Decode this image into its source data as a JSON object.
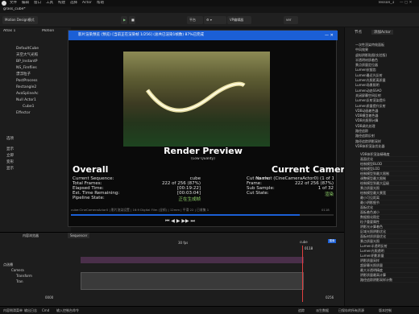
{
  "menu": {
    "items": [
      "文件",
      "编辑",
      "窗口",
      "工具",
      "构建",
      "选择",
      "Actor",
      "帮助"
    ],
    "project": "grass_cube*",
    "tab_lesson": "lesson_1"
  },
  "toolbar": {
    "mode": "Motion Design模式",
    "label_a": "播放选项",
    "label_b": "平台",
    "dropdown": "VP编辑器",
    "search_ph": "ver"
  },
  "left_panel": {
    "title_a": "Atlas 1",
    "title_b": "Motion",
    "outliner": [
      "DefaultCube",
      "天空大气光照",
      "BP_InstantP",
      "NS_Fireflies",
      "漂浮粒子",
      "PostProcess",
      "Rectangle2",
      "AvaSplineAc",
      "Null Actor1",
      "Cube1",
      "Effector"
    ],
    "details_title": "选项",
    "details": [
      "显示",
      "立即",
      "变形",
      "显示"
    ]
  },
  "dialog": {
    "title": "影片渲染预览 (预览) [当前正在渲染帧 1/256] (总共已渲染1帧数) 87%已完成",
    "render_title": "Render Preview",
    "render_sub": "(Low Quality)",
    "overall": "Overall",
    "current": "Current Camera Cut",
    "left_stats": [
      [
        "Current Sequence:",
        "cube"
      ],
      [
        "Total Frames:",
        "222 of 256 (87%)"
      ],
      [
        "Elapsed Time:",
        "[00:19:22]"
      ],
      [
        "Est. Time Remaining:",
        "[00:03:04]"
      ],
      [
        "Pipeline State:",
        "正在生成帧"
      ]
    ],
    "right_stats": [
      [
        "Cut Name:",
        "no shot (CineCameraActor0) (1 of 1)"
      ],
      [
        "Frame:",
        "222 of 256 (87%)"
      ],
      [
        "Sub Sample:",
        "1 of 32"
      ],
      [
        "Cut State:",
        "渲染"
      ]
    ],
    "footer": "cube:CineCameraActor0 | 影片渲染设置 | 16:9 Digital Film (全帧) | 12mm | 平滑 22 | 已收集 1",
    "footer_right": "0118"
  },
  "right_panel": {
    "title": "节点",
    "add": "添加Actor",
    "items": [
      "一次性渲染特效面板",
      "中风效果",
      "虚拟阴影贴图(实验版)",
      "半透明材质着色",
      "景点质量定位器",
      "Lumen抗锯齿",
      "Lumen最近光反射",
      "Lumen光照距离质量",
      "Lumen场景照明",
      "Lumen动态SSAO",
      "关闭屏幕空间反射",
      "Lumen反射渲染提升",
      "Lumen质量提升反射",
      "VDB动画着色器",
      "VDB模型着色器",
      "VDB光照预计算",
      "VDB调光处理",
      "路径追踪",
      "路径追踪反射",
      "路径追踪阴影采样",
      "VDB体积渲染优化器"
    ],
    "items2": [
      "VDB体积渲染精确度",
      "画面优化",
      "绘制模型BLOD",
      "绘制模型LOD",
      "绘制模型到最大限制",
      "调整模型最大限制",
      "绘制模型到最大层级",
      "景点质量光照",
      "绘制模型最大景宽",
      "最小可见距离",
      "最小阴影细节",
      "面板优化",
      "面板着色减小",
      "数据细化稳定",
      "粒子重要属性",
      "阴影光计算着色",
      "区域光照阴影优化",
      "面板材质质量优化",
      "景点质量光照",
      "Lumen半透明反射",
      "Lumen光照透明",
      "Lumen阴影质量",
      "阴影质量采样",
      "超屏幕光照质量",
      "最大半透明精度",
      "阴影质量最高计算",
      "路径追踪阴影采样计数"
    ]
  },
  "sequencer": {
    "tab1": "内容浏览器",
    "tab2": "Sequencer",
    "fps": "30 fps",
    "seq_name": "cube",
    "search": "搜索",
    "tracks": [
      "点选播",
      "Camera",
      "Transform",
      "Tran"
    ],
    "frame": "0118",
    "frame2": "0000",
    "range_end": "0256"
  },
  "status": {
    "items": [
      "内容侧滑菜单",
      "输出日志",
      "Cmd",
      "输入控制台命令",
      "追踪",
      "派生数据",
      "已保存的所有资源",
      "版本控制"
    ]
  },
  "colors": {
    "accent": "#1b5fd6",
    "play": "#7ec07e"
  }
}
